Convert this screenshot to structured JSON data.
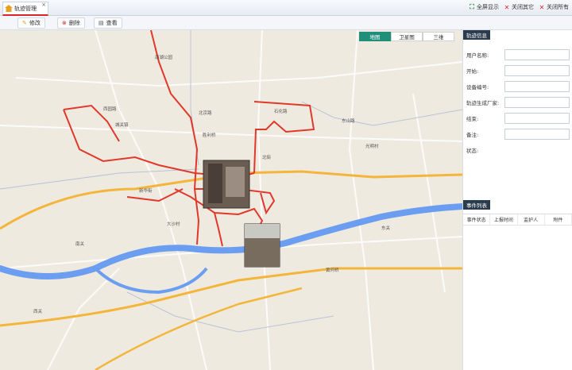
{
  "tab": {
    "label": "轨迹管理"
  },
  "top_actions": [
    {
      "label": "全屏显示",
      "icon": "fullscreen-icon"
    },
    {
      "label": "关闭其它",
      "icon": "close-icon"
    },
    {
      "label": "关闭所有",
      "icon": "close-icon"
    }
  ],
  "toolbar": [
    {
      "label": "修改",
      "icon": "edit-icon"
    },
    {
      "label": "删除",
      "icon": "delete-icon"
    },
    {
      "label": "查看",
      "icon": "view-icon"
    }
  ],
  "map_types": [
    {
      "label": "地图",
      "active": true
    },
    {
      "label": "卫星图",
      "active": false
    },
    {
      "label": "三维",
      "active": false
    }
  ],
  "panel": {
    "info_title": "轨迹信息",
    "fields": [
      {
        "label": "用户名称:",
        "value": ""
      },
      {
        "label": "开始:",
        "value": ""
      },
      {
        "label": "设备编号:",
        "value": ""
      },
      {
        "label": "轨迹生成厂家:",
        "value": ""
      },
      {
        "label": "结束:",
        "value": ""
      },
      {
        "label": "备注:",
        "value": ""
      },
      {
        "label": "状态:",
        "value": ""
      }
    ],
    "events_title": "事件列表",
    "event_columns": [
      "事件状态",
      "上报时间",
      "监护人",
      "附件"
    ]
  },
  "map_labels": [
    "西园路",
    "北京路",
    "胜利桥",
    "石化路",
    "黄河桥",
    "新华街",
    "北街",
    "东山路",
    "南湖公园",
    "城关镇",
    "大沙村",
    "光明村",
    "南关",
    "西关",
    "东关"
  ],
  "colors": {
    "track": "#e0392b",
    "river": "#6b9ef0",
    "highway": "#f3b53a",
    "panel_head": "#2b3b4e",
    "map_active": "#1f8f7a"
  }
}
